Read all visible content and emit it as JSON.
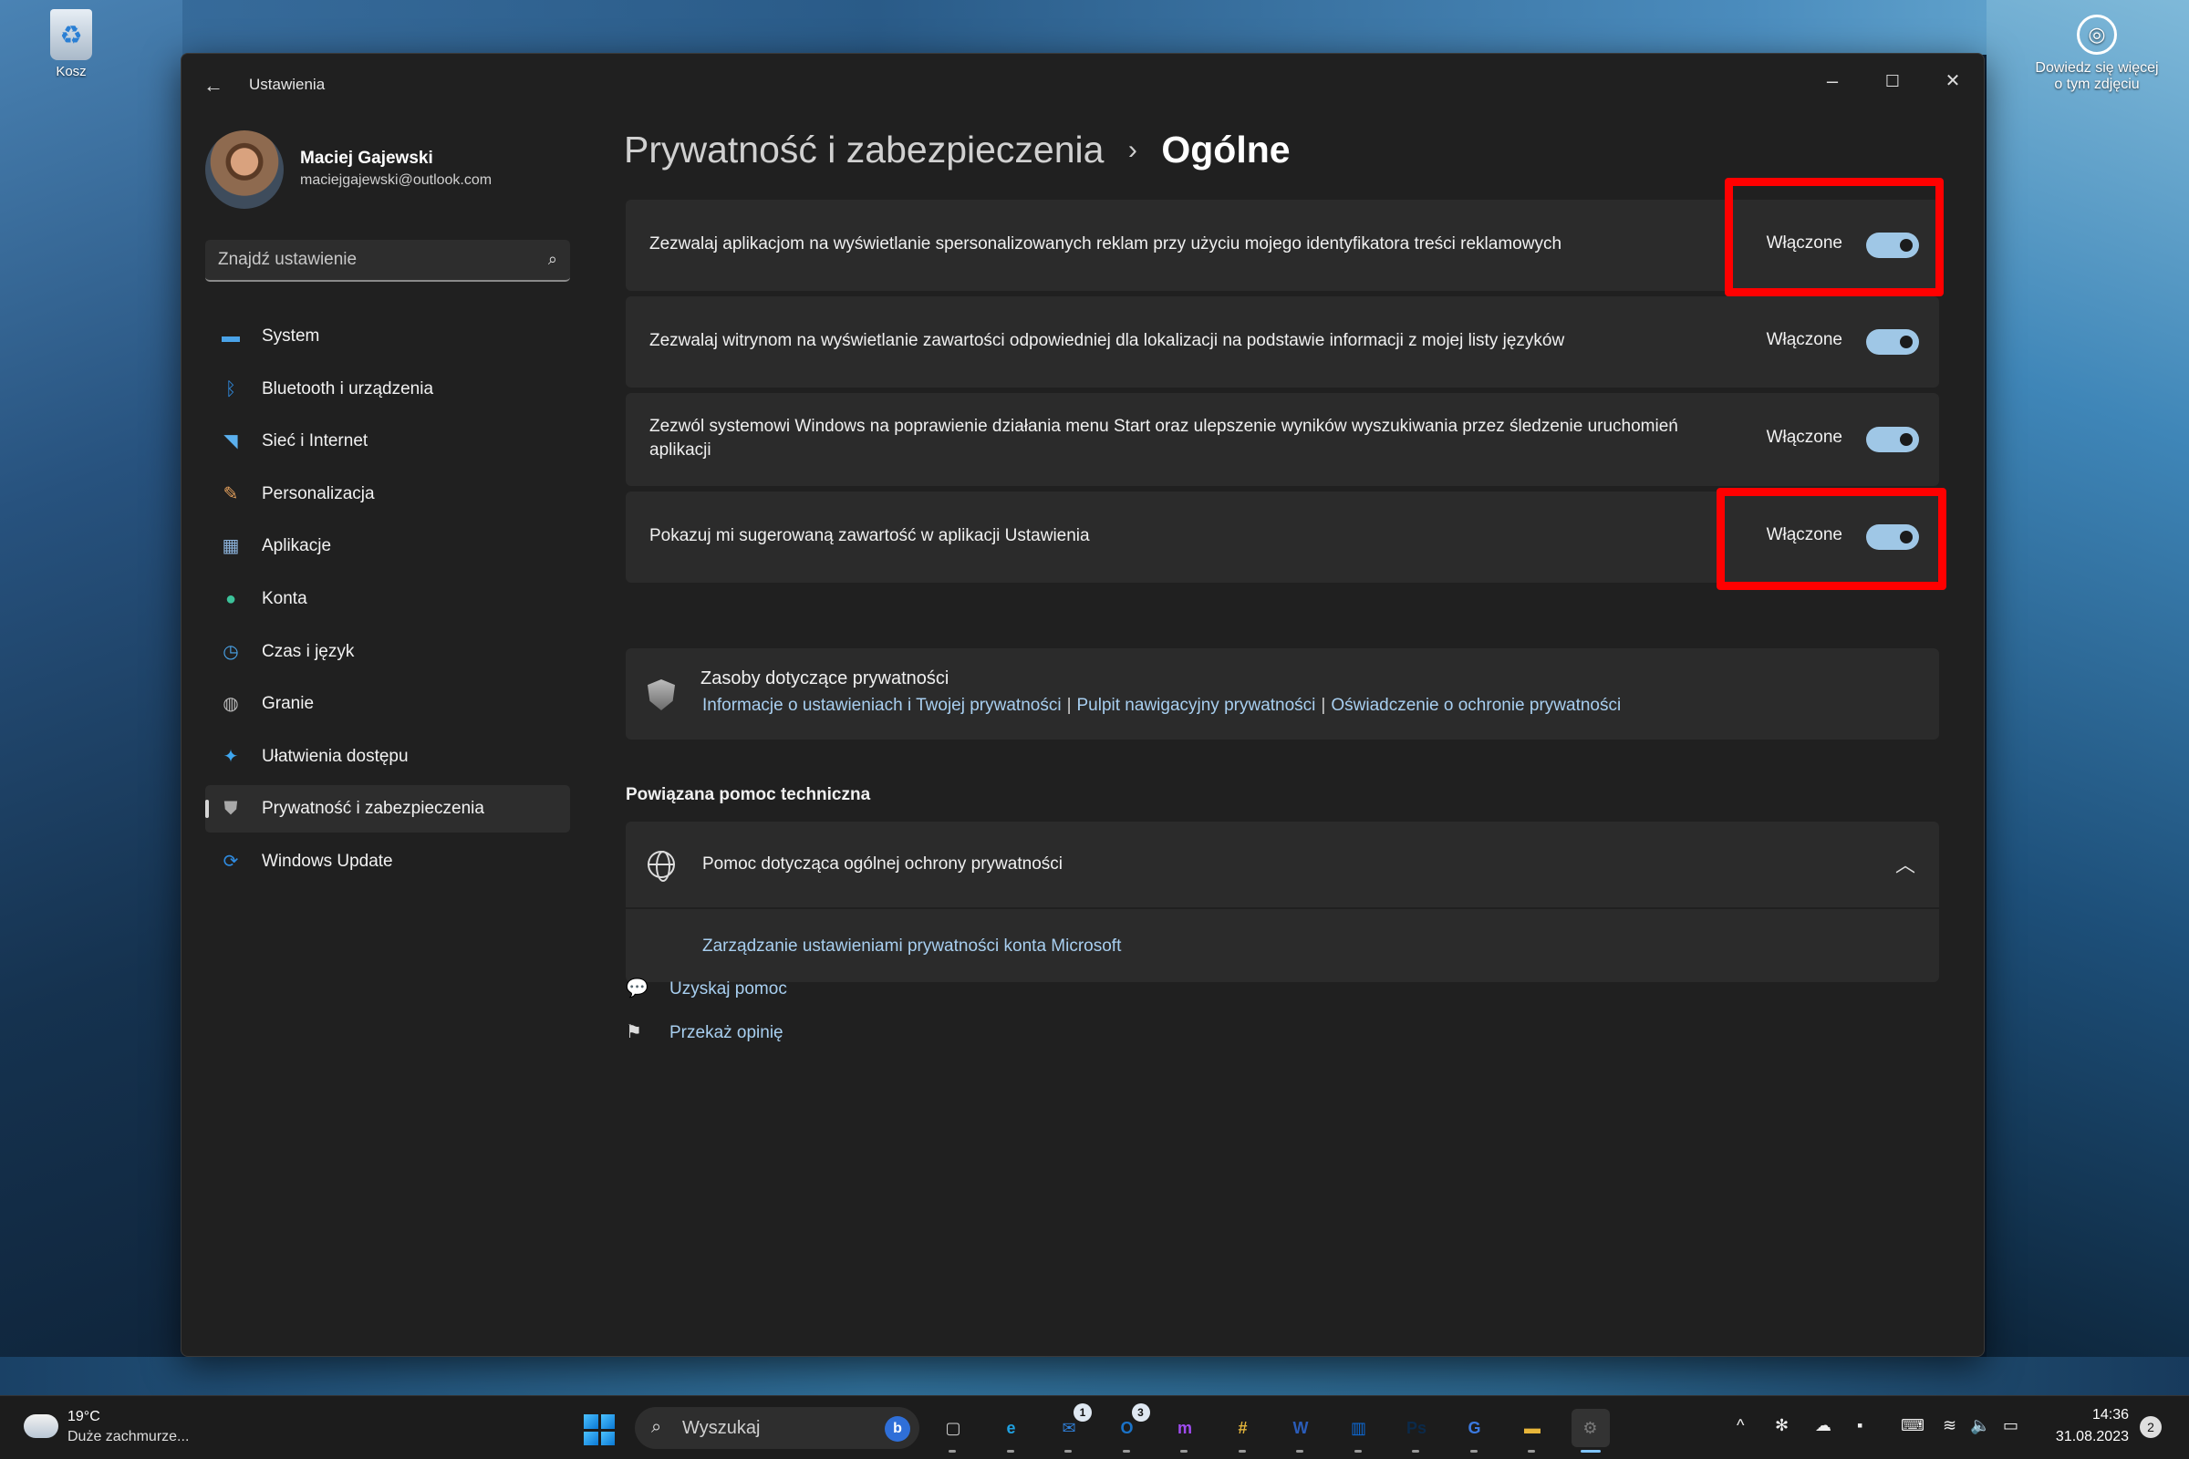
{
  "desktop": {
    "recycle_bin_label": "Kosz",
    "spotlight_line1": "Dowiedz się więcej",
    "spotlight_line2": "o tym zdjęciu"
  },
  "window": {
    "title": "Ustawienia",
    "controls": {
      "minimize": "–",
      "maximize": "☐",
      "close": "✕"
    }
  },
  "profile": {
    "name": "Maciej Gajewski",
    "email": "maciejgajewski@outlook.com"
  },
  "search": {
    "placeholder": "Znajdź ustawienie"
  },
  "nav": {
    "items": [
      {
        "label": "System",
        "icon": "monitor-icon",
        "color": "#4aa3e8"
      },
      {
        "label": "Bluetooth i urządzenia",
        "icon": "bluetooth-icon",
        "color": "#2f8be0"
      },
      {
        "label": "Sieć i Internet",
        "icon": "wifi-icon",
        "color": "#5bb0ee"
      },
      {
        "label": "Personalizacja",
        "icon": "brush-icon",
        "color": "#e4a05c"
      },
      {
        "label": "Aplikacje",
        "icon": "apps-icon",
        "color": "#8ab0d8"
      },
      {
        "label": "Konta",
        "icon": "person-icon",
        "color": "#3cc29a"
      },
      {
        "label": "Czas i język",
        "icon": "clock-globe-icon",
        "color": "#4aa3e8"
      },
      {
        "label": "Granie",
        "icon": "gamepad-icon",
        "color": "#b8b8b8"
      },
      {
        "label": "Ułatwienia dostępu",
        "icon": "accessibility-icon",
        "color": "#3fa7f0"
      },
      {
        "label": "Prywatność i zabezpieczenia",
        "icon": "shield-icon",
        "color": "#a9a9a9"
      },
      {
        "label": "Windows Update",
        "icon": "update-icon",
        "color": "#2f8be0"
      }
    ],
    "active_index": 9
  },
  "breadcrumb": {
    "parent": "Prywatność i zabezpieczenia",
    "separator": "›",
    "current": "Ogólne"
  },
  "settings": [
    {
      "text": "Zezwalaj aplikacjom na wyświetlanie spersonalizowanych reklam przy użyciu mojego identyfikatora treści reklamowych",
      "state": "Włączone",
      "on": true
    },
    {
      "text": "Zezwalaj witrynom na wyświetlanie zawartości odpowiedniej dla lokalizacji na podstawie informacji z mojej listy języków",
      "state": "Włączone",
      "on": true
    },
    {
      "text": "Zezwól systemowi Windows na poprawienie działania menu Start oraz ulepszenie wyników wyszukiwania przez śledzenie uruchomień aplikacji",
      "state": "Włączone",
      "on": true
    },
    {
      "text": "Pokazuj mi sugerowaną zawartość w aplikacji Ustawienia",
      "state": "Włączone",
      "on": true
    }
  ],
  "resources": {
    "title": "Zasoby dotyczące prywatności",
    "links": [
      "Informacje o ustawieniach i Twojej prywatności",
      "Pulpit nawigacyjny prywatności",
      "Oświadczenie o ochronie prywatności"
    ],
    "separator": "|"
  },
  "related": {
    "heading": "Powiązana pomoc techniczna",
    "expander_title": "Pomoc dotycząca ogólnej ochrony prywatności",
    "expander_link": "Zarządzanie ustawieniami prywatności konta Microsoft"
  },
  "footer": {
    "get_help": "Uzyskaj pomoc",
    "feedback": "Przekaż opinię"
  },
  "taskbar": {
    "weather_temp": "19°C",
    "weather_desc": "Duże zachmurze...",
    "search_placeholder": "Wyszukaj",
    "bing_letter": "b",
    "apps": [
      {
        "name": "task-view",
        "glyph": "▢",
        "color": "#cfcfcf"
      },
      {
        "name": "edge",
        "glyph": "e",
        "color": "#1fa0e0"
      },
      {
        "name": "mail",
        "glyph": "✉",
        "color": "#2f7fd8",
        "badge": "1"
      },
      {
        "name": "outlook",
        "glyph": "O",
        "color": "#1a73c8",
        "badge": "3"
      },
      {
        "name": "messenger",
        "glyph": "m",
        "color": "#a04cf0"
      },
      {
        "name": "slack",
        "glyph": "#",
        "color": "#e0b23a"
      },
      {
        "name": "word",
        "glyph": "W",
        "color": "#2a5cb8"
      },
      {
        "name": "trello",
        "glyph": "▥",
        "color": "#0c6ad8"
      },
      {
        "name": "photoshop",
        "glyph": "Ps",
        "color": "#0b2a4a"
      },
      {
        "name": "translate",
        "glyph": "G",
        "color": "#3b7ae0"
      },
      {
        "name": "explorer",
        "glyph": "▬",
        "color": "#e8b63a"
      },
      {
        "name": "settings",
        "glyph": "⚙",
        "color": "#7a7a7a",
        "active": true
      }
    ],
    "tray": {
      "chevron": "^",
      "time": "14:36",
      "date": "31.08.2023",
      "notifications": "2"
    }
  },
  "colors": {
    "highlight": "#ff0000",
    "toggle_on": "#9fc7e6",
    "link": "#a8cff0"
  }
}
